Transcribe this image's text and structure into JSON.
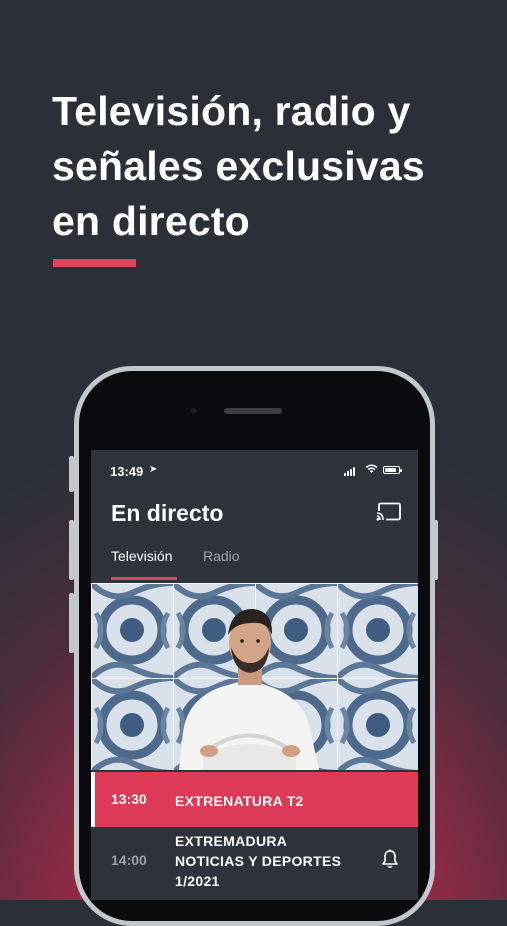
{
  "promo": {
    "headline_lines": [
      "Televisión, radio y",
      "señales exclusivas",
      "en directo"
    ],
    "accent_color": "#e04360"
  },
  "status_bar": {
    "time": "13:49",
    "location_icon": "location-arrow-icon",
    "icons": [
      "cellular-signal-icon",
      "wifi-icon",
      "battery-icon"
    ]
  },
  "app": {
    "title": "En directo",
    "cast_icon": "cast-icon",
    "tabs": [
      {
        "label": "Televisión",
        "active": true
      },
      {
        "label": "Radio",
        "active": false
      }
    ]
  },
  "schedule": [
    {
      "time": "13:30",
      "title": "EXTRENATURA T2",
      "live": true
    },
    {
      "time": "14:00",
      "title_lines": [
        "EXTREMADURA",
        "NOTICIAS Y DEPORTES",
        "1/2021"
      ],
      "live": false,
      "icon": "bell-icon"
    }
  ]
}
